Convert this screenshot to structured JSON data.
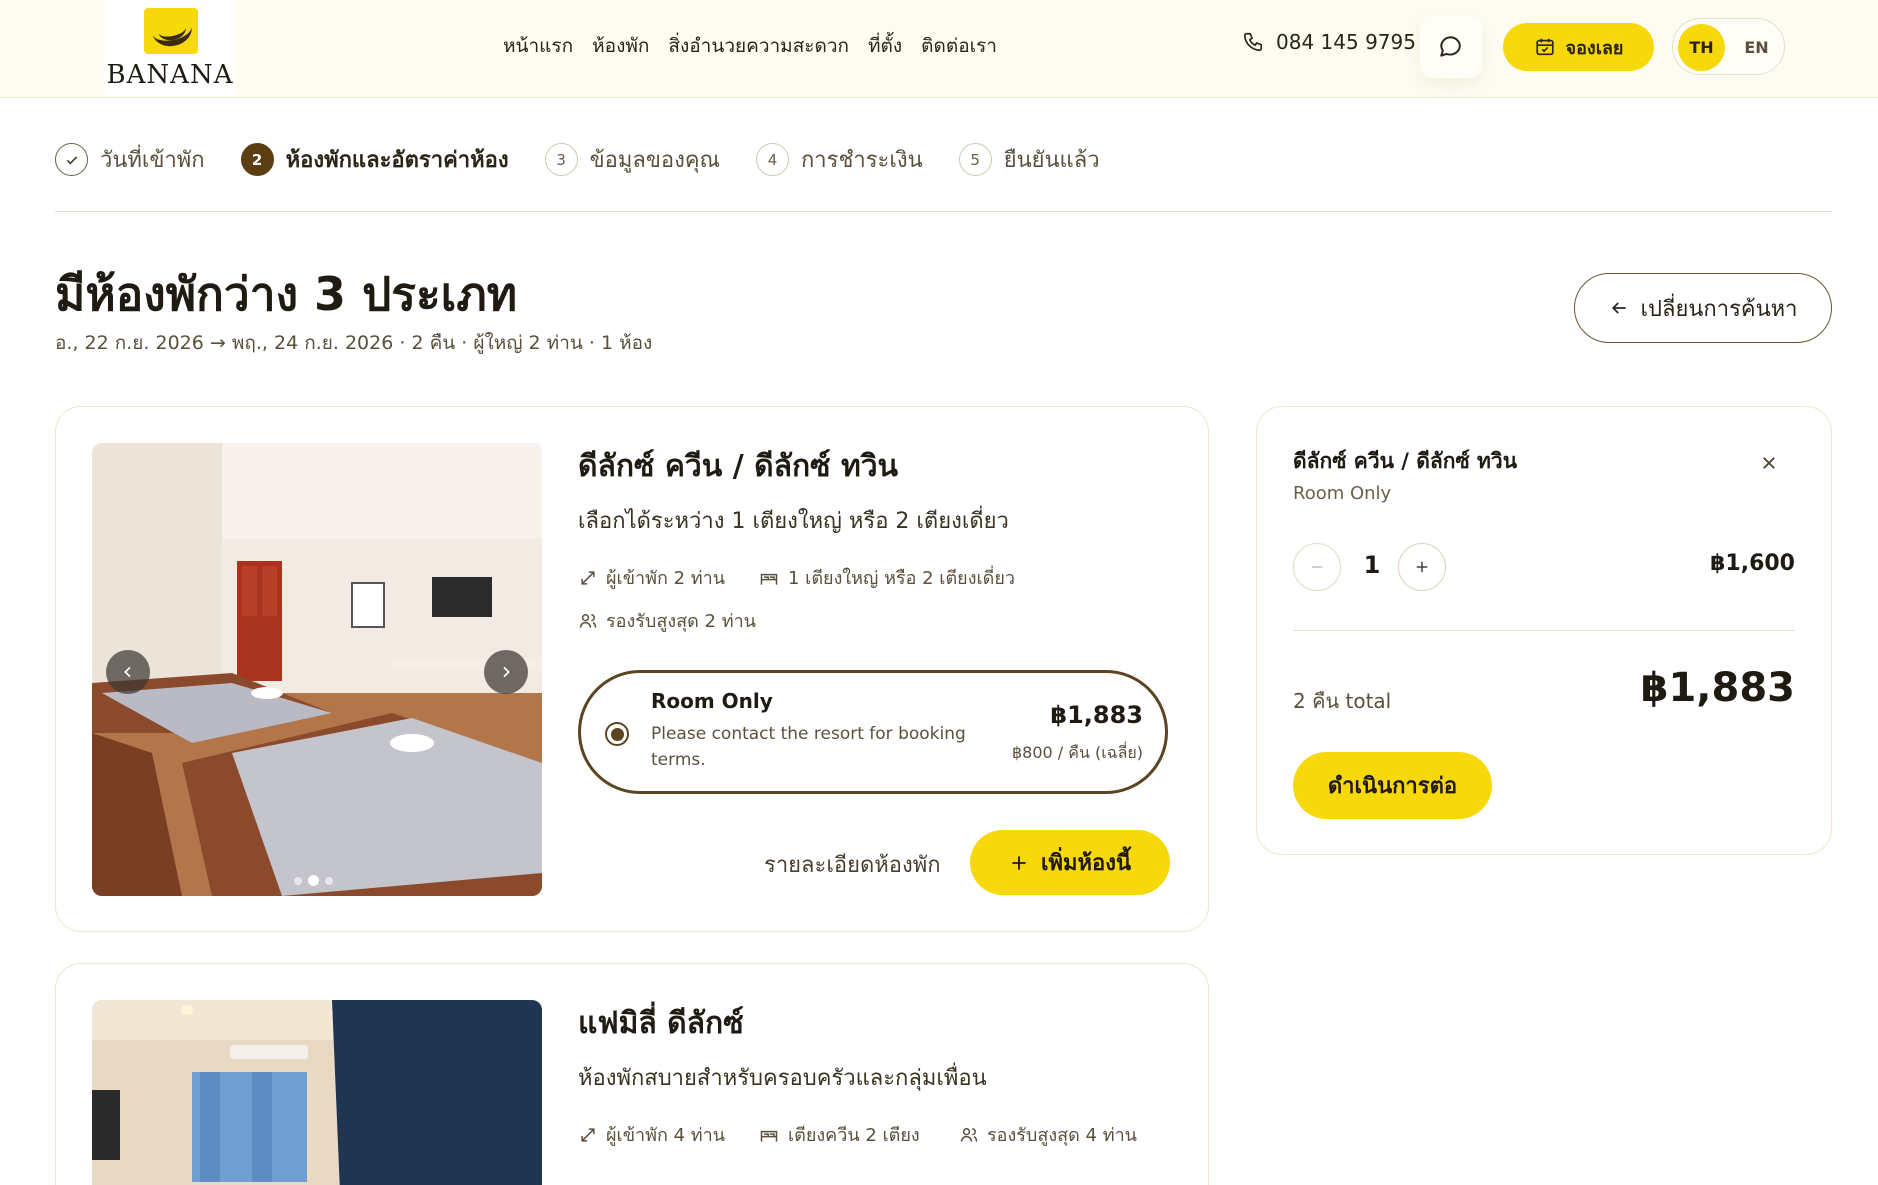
{
  "brand": {
    "name": "BANANA"
  },
  "nav": [
    "หน้าแรก",
    "ห้องพัก",
    "สิ่งอำนวยความสะดวก",
    "ที่ตั้ง",
    "ติดต่อเรา"
  ],
  "header": {
    "phone": "084 145 9795",
    "book_label": "จองเลย",
    "lang_th": "TH",
    "lang_en": "EN"
  },
  "steps": [
    {
      "num": "✓",
      "label": "วันที่เข้าพัก"
    },
    {
      "num": "2",
      "label": "ห้องพักและอัตราค่าห้อง"
    },
    {
      "num": "3",
      "label": "ข้อมูลของคุณ"
    },
    {
      "num": "4",
      "label": "การชำระเงิน"
    },
    {
      "num": "5",
      "label": "ยืนยันแล้ว"
    }
  ],
  "heading": {
    "title": "มีห้องพักว่าง 3 ประเภท",
    "subtitle": "อ., 22 ก.ย. 2026 → พฤ., 24 ก.ย. 2026 · 2 คืน · ผู้ใหญ่ 2 ท่าน · 1 ห้อง",
    "change_search": "เปลี่ยนการค้นหา"
  },
  "rooms": [
    {
      "name": "ดีลักซ์ ควีน / ดีลักซ์ ทวิน",
      "description": "เลือกได้ระหว่าง 1 เตียงใหญ่ หรือ 2 เตียงเดี่ยว",
      "features": [
        "ผู้เข้าพัก 2 ท่าน",
        "1 เตียงใหญ่ หรือ 2 เตียงเดี่ยว",
        "รองรับสูงสุด 2 ท่าน"
      ],
      "rate": {
        "title": "Room Only",
        "note": "Please contact the resort for booking terms.",
        "price": "฿1,883",
        "per_night": "฿800 / คืน (เฉลี่ย)"
      },
      "details_link": "รายละเอียดห้องพัก",
      "add_label": "เพิ่มห้องนี้"
    },
    {
      "name": "แฟมิลี่ ดีลักซ์",
      "description": "ห้องพักสบายสำหรับครอบครัวและกลุ่มเพื่อน",
      "features": [
        "ผู้เข้าพัก 4 ท่าน",
        "เตียงควีน 2 เตียง",
        "รองรับสูงสุด 4 ท่าน"
      ]
    }
  ],
  "summary": {
    "room_name": "ดีลักซ์ ควีน / ดีลักซ์ ทวิน",
    "rate": "Room Only",
    "quantity": "1",
    "line_price": "฿1,600",
    "total_label": "2 คืน total",
    "total": "฿1,883",
    "continue_label": "ดำเนินการต่อ"
  },
  "colors": {
    "accent": "#f6d80b",
    "brand_brown": "#5b3e12",
    "header_bg": "#fefbf0"
  }
}
